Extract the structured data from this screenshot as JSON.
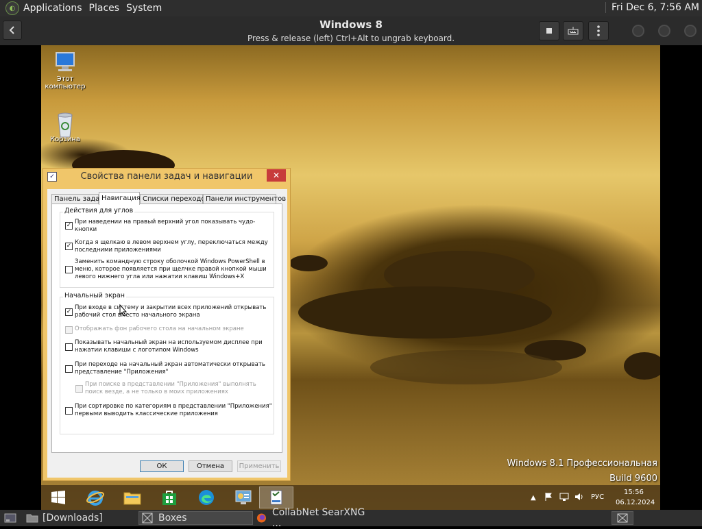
{
  "top_panel": {
    "menus": [
      "Applications",
      "Places",
      "System"
    ],
    "clock": "Fri Dec  6,  7:56 AM"
  },
  "boxes_header": {
    "title": "Windows 8",
    "subtitle": "Press & release (left) Ctrl+Alt to ungrab keyboard."
  },
  "desktop": {
    "icons": [
      {
        "label": "Этот компьютер",
        "icon": "computer-icon"
      },
      {
        "label": "Корзина",
        "icon": "recycle-bin-icon"
      }
    ],
    "watermark": {
      "edition": "Windows 8.1 Профессиональная",
      "build": "Build 9600"
    }
  },
  "dialog": {
    "title": "Свойства панели задач и навигации",
    "close_label": "✕",
    "tabs": [
      "Панель задач",
      "Навигация",
      "Списки переходов",
      "Панели инструментов"
    ],
    "active_tab": "Навигация",
    "groups": [
      {
        "title": "Действия для углов",
        "options": [
          {
            "label": "При наведении на правый верхний угол показывать чудо-кнопки",
            "checked": true,
            "disabled": false
          },
          {
            "label": "Когда я щелкаю в левом верхнем углу, переключаться между последними приложениями",
            "checked": true,
            "disabled": false
          },
          {
            "label": "Заменить командную строку оболочкой Windows PowerShell в меню, которое появляется при щелчке правой кнопкой мыши левого нижнего угла или нажатии клавиш Windows+X",
            "checked": false,
            "disabled": false
          }
        ]
      },
      {
        "title": "Начальный экран",
        "options": [
          {
            "label": "При входе в систему и закрытии всех приложений открывать рабочий стол вместо начального экрана",
            "checked": true,
            "disabled": false
          },
          {
            "label": "Отображать фон рабочего стола на начальном экране",
            "checked": false,
            "disabled": true
          },
          {
            "label": "Показывать начальный экран на используемом дисплее при нажатии клавиши с логотипом Windows",
            "checked": false,
            "disabled": false
          },
          {
            "label": "При переходе на начальный экран автоматически открывать представление \"Приложения\"",
            "checked": false,
            "disabled": false
          },
          {
            "label": "При поиске в представлении \"Приложения\" выполнять поиск везде, а не только в моих приложениях",
            "checked": false,
            "disabled": true
          },
          {
            "label": "При сортировке по категориям в представлении \"Приложения\" первыми выводить классические приложения",
            "checked": false,
            "disabled": false
          }
        ]
      }
    ],
    "buttons": {
      "ok": "ОК",
      "cancel": "Отмена",
      "apply": "Применить"
    }
  },
  "win_taskbar": {
    "apps": [
      "start-icon",
      "internet-explorer-icon",
      "file-explorer-icon",
      "store-icon",
      "edge-icon",
      "control-panel-icon",
      "taskbar-properties-icon"
    ],
    "tray": {
      "language": "РУС",
      "time": "15:56",
      "date": "06.12.2024"
    }
  },
  "bottom_panel": {
    "items": [
      "[Downloads]",
      "Boxes",
      "CollabNet SearXNG ..."
    ]
  },
  "colors": {
    "gnome_panel": "#2e2e2e",
    "dialog_frame": "#f0c66a",
    "close_red": "#c73b3b",
    "win_taskbar": "#46321A"
  }
}
